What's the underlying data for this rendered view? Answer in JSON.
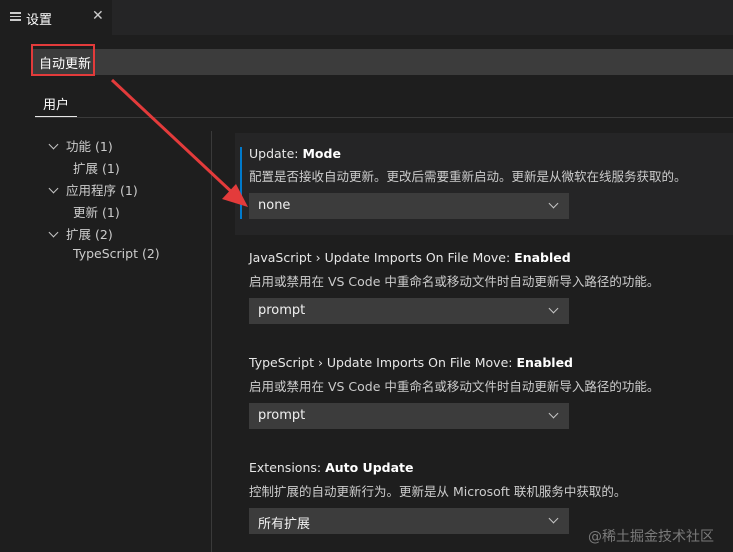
{
  "tab": {
    "title": "设置",
    "icon": "settings-list-icon",
    "close": "✕"
  },
  "search": {
    "value": "自动更新",
    "highlight_color": "#e33b3b"
  },
  "scope_tabs": [
    {
      "label": "用户"
    }
  ],
  "toc": [
    {
      "label": "功能",
      "count": "(1)"
    },
    {
      "label": "扩展",
      "count": "(1)"
    },
    {
      "label": "应用程序",
      "count": "(1)"
    },
    {
      "label": "更新",
      "count": "(1)"
    },
    {
      "label": "扩展",
      "count": "(2)"
    },
    {
      "label": "TypeScript",
      "count": "(2)"
    }
  ],
  "settings": [
    {
      "category": "Update: ",
      "name": "Mode",
      "description": "配置是否接收自动更新。更改后需要重新启动。更新是从微软在线服务获取的。",
      "value": "none"
    },
    {
      "category": "JavaScript › Update Imports On File Move: ",
      "name": "Enabled",
      "description": "启用或禁用在 VS Code 中重命名或移动文件时自动更新导入路径的功能。",
      "value": "prompt"
    },
    {
      "category": "TypeScript › Update Imports On File Move: ",
      "name": "Enabled",
      "description": "启用或禁用在 VS Code 中重命名或移动文件时自动更新导入路径的功能。",
      "value": "prompt"
    },
    {
      "category": "Extensions: ",
      "name": "Auto Update",
      "description": "控制扩展的自动更新行为。更新是从 Microsoft 联机服务中获取的。",
      "value": "所有扩展"
    }
  ],
  "colors": {
    "focus_accent": "#007acc",
    "annotation_red": "#e33b3b"
  },
  "watermark": "@稀土掘金技术社区"
}
